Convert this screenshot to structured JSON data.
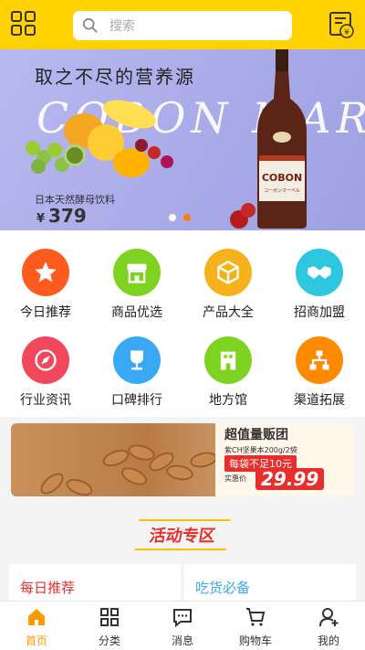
{
  "header": {
    "search_placeholder": "搜索",
    "accent_color": "#ffd200"
  },
  "banner": {
    "tagline": "取之不尽的营养源",
    "script_text": "COBON MARVEL",
    "bottle_brand": "COBON",
    "bottle_sub": "コーボンマーベル",
    "product_name": "日本天然酵母饮料",
    "currency": "¥",
    "price": "379",
    "active_slide": 2,
    "slide_count": 2
  },
  "categories": [
    {
      "label": "今日推荐",
      "color": "#ff5b1e",
      "icon": "star-icon"
    },
    {
      "label": "商品优选",
      "color": "#7ed321",
      "icon": "store-icon"
    },
    {
      "label": "产品大全",
      "color": "#f6b21b",
      "icon": "box-icon"
    },
    {
      "label": "招商加盟",
      "color": "#2ec7e0",
      "icon": "handshake-icon"
    },
    {
      "label": "行业资讯",
      "color": "#f2485c",
      "icon": "compass-icon"
    },
    {
      "label": "口碑排行",
      "color": "#3aa9f5",
      "icon": "trophy-icon"
    },
    {
      "label": "地方馆",
      "color": "#7ed321",
      "icon": "building-icon"
    },
    {
      "label": "渠道拓展",
      "color": "#ff8a00",
      "icon": "hierarchy-icon"
    }
  ],
  "promo": {
    "title": "超值量贩团",
    "line1": "紫CH坚果本200g/2袋",
    "badge": "每袋不足10元",
    "price_label": "实惠价",
    "price": "29.99"
  },
  "activity": {
    "section_title": "活动专区",
    "cards": [
      {
        "label": "每日推荐",
        "color": "#e82d2d"
      },
      {
        "label": "吃货必备",
        "color": "#3aa9f5"
      }
    ]
  },
  "tabbar": [
    {
      "label": "首页",
      "icon": "home-icon",
      "active": true
    },
    {
      "label": "分类",
      "icon": "category-icon",
      "active": false
    },
    {
      "label": "消息",
      "icon": "message-icon",
      "active": false
    },
    {
      "label": "购物车",
      "icon": "cart-icon",
      "active": false
    },
    {
      "label": "我的",
      "icon": "user-icon",
      "active": false
    }
  ]
}
